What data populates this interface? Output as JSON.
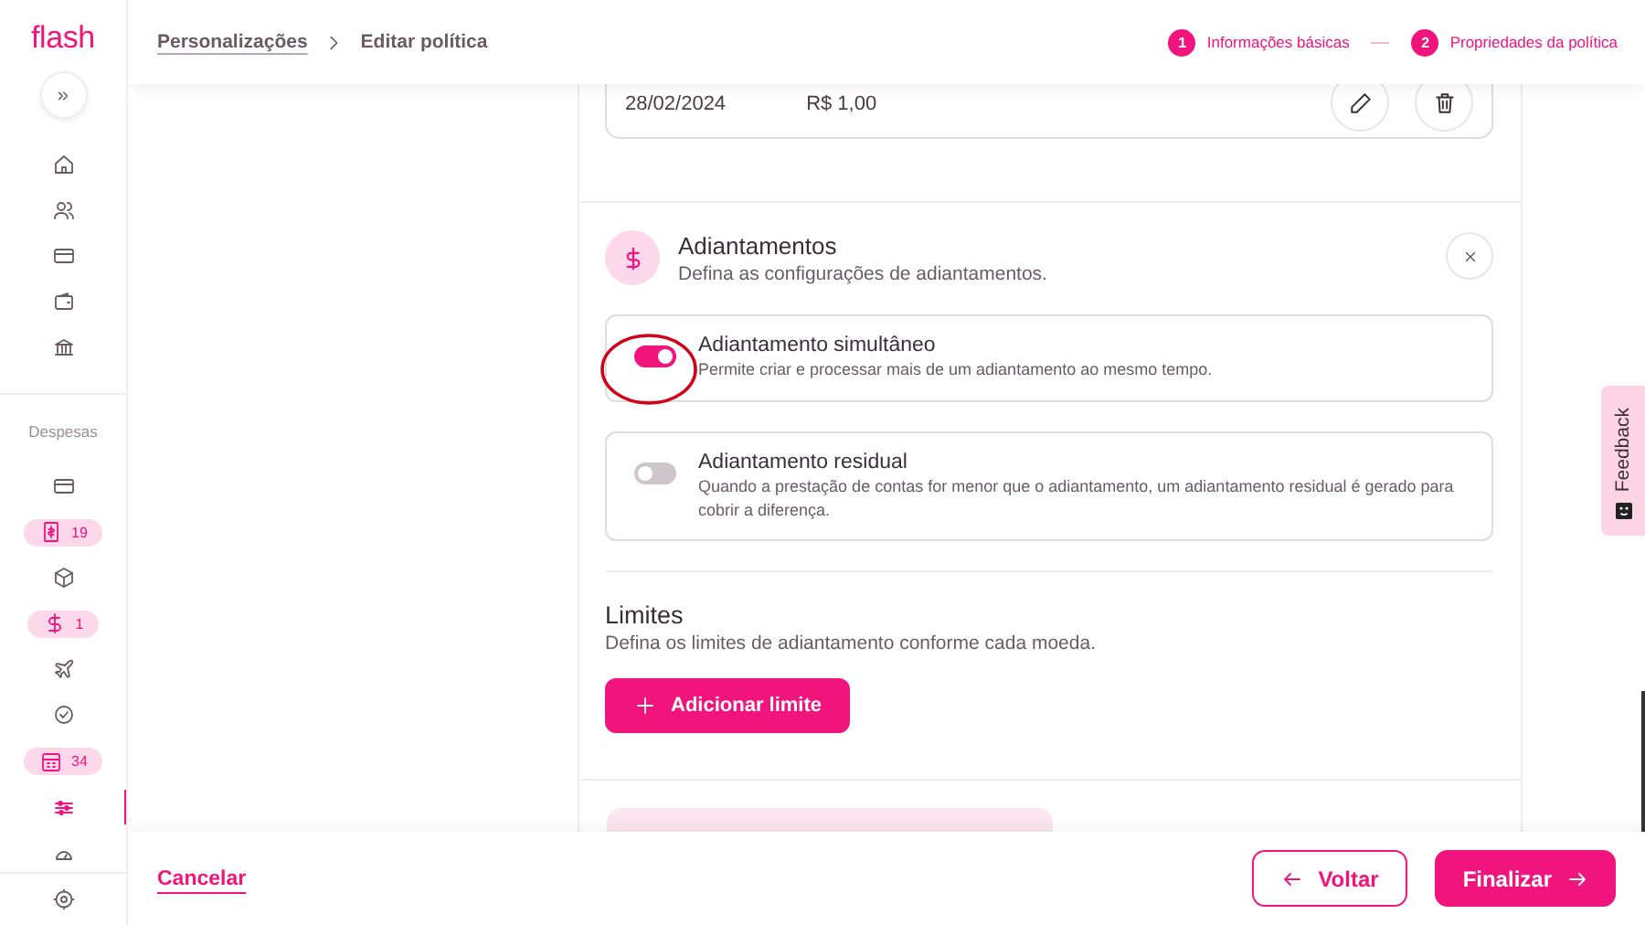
{
  "header": {
    "logo": "flash",
    "breadcrumb": [
      {
        "label": "Personalizações",
        "link": true
      },
      {
        "label": "Editar política",
        "link": false
      }
    ],
    "steps": [
      {
        "number": "1",
        "label": "Informações básicas"
      },
      {
        "number": "2",
        "label": "Propriedades da política"
      }
    ]
  },
  "sidebar": {
    "section_label": "Despesas",
    "top_items": [
      {
        "selected": false
      },
      {
        "selected": false
      },
      {
        "selected": false
      },
      {
        "selected": false
      },
      {
        "selected": false
      }
    ],
    "items": [
      {
        "kind": "icon",
        "selected": false
      },
      {
        "kind": "badge",
        "count": "19",
        "selected": false
      },
      {
        "kind": "icon",
        "selected": false
      },
      {
        "kind": "badge",
        "count": "1",
        "selected": false
      },
      {
        "kind": "icon",
        "selected": false
      },
      {
        "kind": "icon",
        "selected": false
      },
      {
        "kind": "badge",
        "count": "34",
        "selected": false
      },
      {
        "kind": "icon",
        "selected": true
      },
      {
        "kind": "icon",
        "selected": false
      }
    ]
  },
  "previous_card": {
    "date": "28/02/2024",
    "amount": "R$ 1,00"
  },
  "section": {
    "title": "Adiantamentos",
    "subtitle": "Defina as configurações de adiantamentos.",
    "options": [
      {
        "title": "Adiantamento simultâneo",
        "description": "Permite criar e processar mais de um adiantamento ao mesmo tempo.",
        "on": true
      },
      {
        "title": "Adiantamento residual",
        "description": "Quando a prestação de contas for menor que o adiantamento, um adiantamento residual é gerado para cobrir a diferença.",
        "on": false
      }
    ]
  },
  "limits": {
    "title": "Limites",
    "subtitle": "Defina os limites de adiantamento conforme cada moeda.",
    "button": "Adicionar limite"
  },
  "footer": {
    "cancel": "Cancelar",
    "back": "Voltar",
    "finish": "Finalizar"
  },
  "feedback": {
    "label": "Feedback"
  }
}
